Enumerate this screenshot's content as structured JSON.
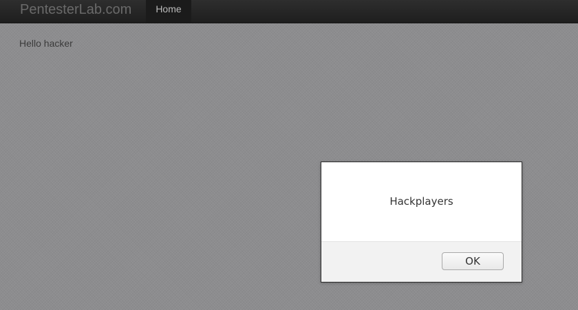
{
  "navbar": {
    "brand": "PentesterLab.com",
    "home_label": "Home"
  },
  "main": {
    "greeting": "Hello hacker"
  },
  "alert": {
    "message": "Hackplayers",
    "ok_label": "OK"
  },
  "colors": {
    "navbar_bg": "#262626",
    "page_bg": "#909092",
    "dialog_bg": "#ffffff",
    "dialog_footer_bg": "#f2f2f2"
  }
}
